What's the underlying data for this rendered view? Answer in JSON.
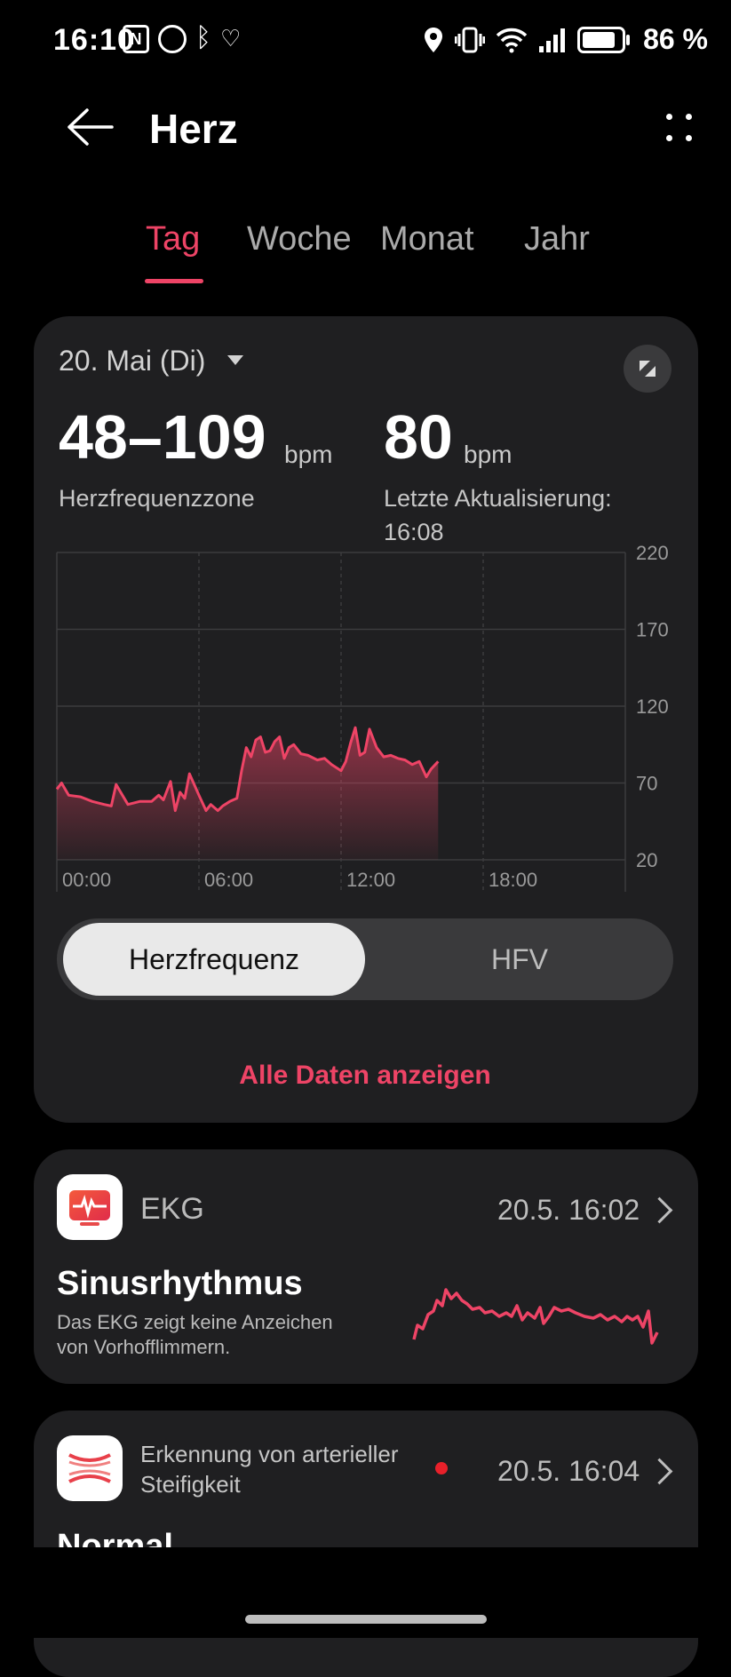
{
  "status_bar": {
    "time": "16:10",
    "left_icons": [
      "nfc-icon",
      "alarm-icon",
      "bluetooth-icon",
      "health-sync-icon"
    ],
    "right_icons": [
      "location-icon",
      "vibrate-icon",
      "wifi-icon",
      "signal-icon",
      "battery-icon"
    ],
    "battery": "86 %",
    "battery_level": 0.86
  },
  "header": {
    "title": "Herz"
  },
  "tabs": [
    {
      "label": "Tag",
      "active": true
    },
    {
      "label": "Woche",
      "active": false
    },
    {
      "label": "Monat",
      "active": false
    },
    {
      "label": "Jahr",
      "active": false
    }
  ],
  "summary": {
    "date": "20. Mai (Di)",
    "range_value": "48–109",
    "range_unit": "bpm",
    "range_label": "Herzfrequenzzone",
    "current_value": "80",
    "current_unit": "bpm",
    "updated_label": "Letzte Aktualisierung:",
    "updated_time": "16:08"
  },
  "chart_data": {
    "type": "area",
    "x_labels": [
      "00:00",
      "06:00",
      "12:00",
      "18:00"
    ],
    "y_ticks": [
      220,
      170,
      120,
      70,
      20
    ],
    "ylim": [
      20,
      220
    ],
    "xlim": [
      0,
      24
    ],
    "grid": true,
    "color": "#ee4466",
    "x": [
      0,
      0.2,
      0.5,
      1,
      1.5,
      2,
      2.3,
      2.5,
      3,
      3.5,
      4,
      4.3,
      4.5,
      4.8,
      5,
      5.2,
      5.4,
      5.6,
      6,
      6.3,
      6.5,
      6.8,
      7,
      7.3,
      7.6,
      7.8,
      8,
      8.2,
      8.4,
      8.6,
      8.8,
      9,
      9.2,
      9.4,
      9.6,
      9.8,
      10,
      10.3,
      10.6,
      11,
      11.3,
      11.6,
      12,
      12.2,
      12.4,
      12.6,
      12.8,
      13,
      13.2,
      13.5,
      13.8,
      14.1,
      14.4,
      14.7,
      15,
      15.3,
      15.6,
      15.8,
      16.1
    ],
    "values": [
      66,
      70,
      62,
      61,
      58,
      56,
      55,
      69,
      56,
      58,
      58,
      62,
      59,
      71,
      52,
      64,
      60,
      76,
      62,
      52,
      56,
      52,
      55,
      58,
      60,
      78,
      93,
      87,
      98,
      100,
      90,
      91,
      97,
      100,
      86,
      93,
      95,
      89,
      88,
      85,
      86,
      82,
      78,
      84,
      96,
      106,
      88,
      90,
      105,
      93,
      87,
      88,
      86,
      85,
      82,
      84,
      74,
      79,
      84
    ]
  },
  "segment": {
    "active": "Herzfrequenz",
    "inactive": "HFV"
  },
  "all_data_link": "Alle Daten anzeigen",
  "ekg": {
    "title": "EKG",
    "datetime": "20.5. 16:02",
    "result": "Sinusrhythmus",
    "description_line1": "Das EKG zeigt keine Anzeichen",
    "description_line2": "von Vorhofflimmern."
  },
  "stiffness": {
    "title_line1": "Erkennung von arterieller",
    "title_line2": "Steifigkeit",
    "datetime": "20.5. 16:04",
    "result": "Normal",
    "dot_color": "#e8202a"
  }
}
